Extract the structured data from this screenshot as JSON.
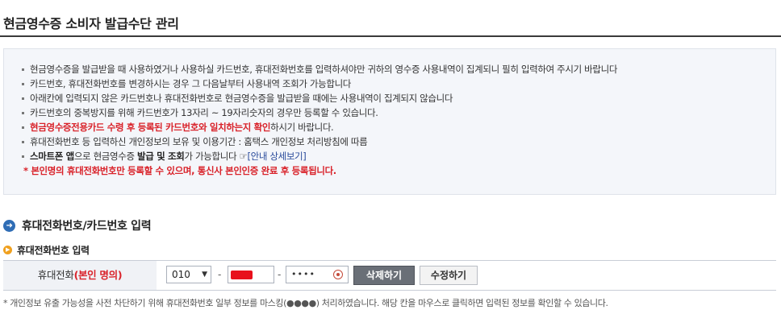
{
  "page_title": "현금영수증 소비자 발급수단 관리",
  "notice": {
    "items": [
      [
        "현금영수증을 발급받을 때 사용하였거나 사용하실 카드번호, 휴대전화번호를 입력하셔야만 귀하의 영수증 사용내역이 집계되니 필히 입력하여 주시기 바랍니다"
      ],
      [
        "카드번호, 휴대전화번호를 변경하시는 경우 그 다음날부터 사용내역 조회가 가능합니다"
      ],
      [
        "아래칸에 입력되지 않은 카드번호나 휴대전화번호로 현금영수증을 발급받을 때에는 사용내역이 집계되지 않습니다"
      ],
      [
        "카드번호의 중복방지를 위해 카드번호가 13자리 ~ 19자리숫자의 경우만 등록할 수 있습니다."
      ],
      [
        "현금영수증전용카드 수령 후 등록된 카드번호와 일치하는지 확인",
        "하시기 바랍니다."
      ],
      [
        "휴대전화번호 등 입력하신 개인정보의 보유 및 이용기간 : 홈택스 개인정보 처리방침에 따름"
      ],
      [
        "스마트폰 앱",
        "으로 현금영수증 ",
        "발급 및 조회",
        "가 가능합니다 ☞",
        "[안내 상세보기]"
      ]
    ],
    "warning": "* 본인명의 휴대전화번호만 등록할 수 있으며, 통신사 본인인증 완료 후 등록됩니다."
  },
  "section": {
    "title": "휴대전화번호/카드번호 입력",
    "subtitle": "휴대전화번호 입력"
  },
  "form": {
    "label": "휴대전화",
    "label_note": "(본인 명의)",
    "prefix_value": "010",
    "dash": "-",
    "last_value": "••••",
    "delete_button": "삭제하기",
    "edit_button": "수정하기"
  },
  "footer_note": "* 개인정보 유출 가능성을 사전 차단하기 위해 휴대전화번호 일부 정보를 마스킹(●●●●) 처리하였습니다. 해당 칸을 마우스로 클릭하면 입력된 정보를 확인할 수 있습니다.",
  "colors": {
    "accent_red": "#d9222a",
    "section_icon_blue": "#2f6db5",
    "sub_icon_orange": "#f0a01e",
    "redaction": "#e8101c"
  },
  "icons": {
    "section": "circle-arrow-icon",
    "subsection": "orange-bullet-icon",
    "toggle": "eye-icon"
  }
}
